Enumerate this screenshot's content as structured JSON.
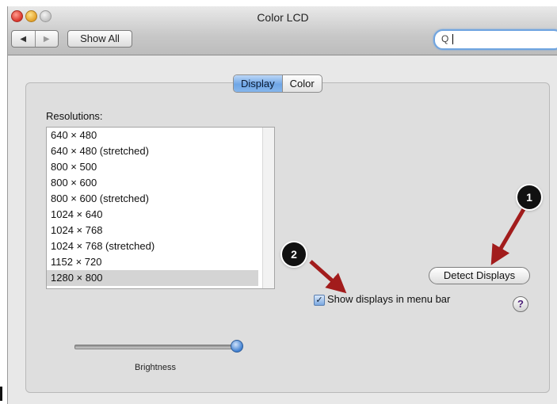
{
  "window": {
    "title": "Color LCD"
  },
  "toolbar": {
    "back_glyph": "◀",
    "forward_glyph": "▶",
    "show_all_label": "Show All",
    "search_icon_glyph": "Q"
  },
  "tabs": [
    {
      "label": "Display",
      "active": true
    },
    {
      "label": "Color",
      "active": false
    }
  ],
  "resolutions": {
    "label": "Resolutions:",
    "items": [
      "640 × 480",
      "640 × 480 (stretched)",
      "800 × 500",
      "800 × 600",
      "800 × 600 (stretched)",
      "1024 × 640",
      "1024 × 768",
      "1024 × 768 (stretched)",
      "1152 × 720",
      "1280 × 800"
    ],
    "selected": "1280 × 800"
  },
  "detect_displays_label": "Detect Displays",
  "show_in_menu_bar": {
    "label": "Show displays in menu bar",
    "checked": true,
    "check_glyph": "✓"
  },
  "help_glyph": "?",
  "brightness": {
    "label": "Brightness",
    "level": 1.0
  },
  "callouts": [
    {
      "number": "1"
    },
    {
      "number": "2"
    }
  ],
  "colors": {
    "accent": "#6fa6e6",
    "arrow": "#a21c1c"
  }
}
